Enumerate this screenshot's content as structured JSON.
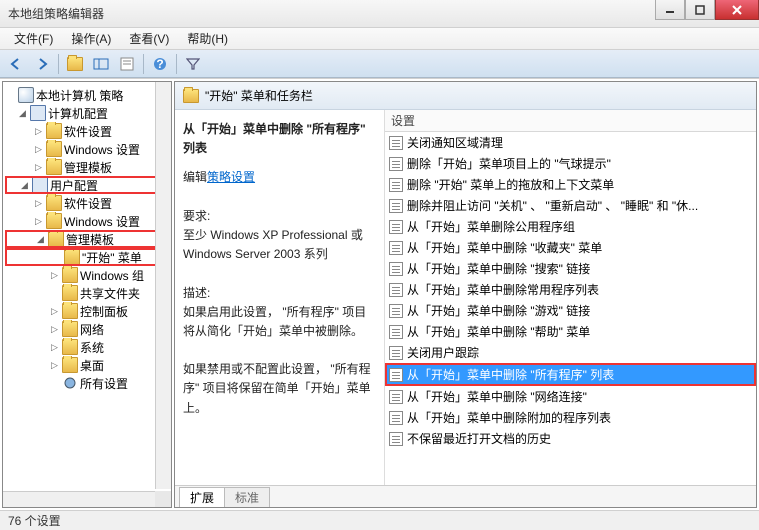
{
  "window": {
    "title": "本地组策略编辑器"
  },
  "menu": {
    "file": "文件(F)",
    "action": "操作(A)",
    "view": "查看(V)",
    "help": "帮助(H)"
  },
  "tree": {
    "root": "本地计算机 策略",
    "computer": "计算机配置",
    "c_software": "软件设置",
    "c_windows": "Windows 设置",
    "c_admin": "管理模板",
    "user": "用户配置",
    "u_software": "软件设置",
    "u_windows": "Windows 设置",
    "u_admin": "管理模板",
    "start_menu": "\"开始\" 菜单",
    "win_comp": "Windows 组",
    "shared": "共享文件夹",
    "cpanel": "控制面板",
    "network": "网络",
    "system": "系统",
    "desktop": "桌面",
    "all_settings": "所有设置"
  },
  "header": {
    "title": "\"开始\" 菜单和任务栏"
  },
  "info": {
    "title": "从「开始」菜单中删除 \"所有程序\" 列表",
    "edit_prefix": "编辑",
    "edit_link": "策略设置",
    "req_label": "要求:",
    "req_text": "至少 Windows XP Professional 或 Windows Server 2003 系列",
    "desc_label": "描述:",
    "desc1": "如果启用此设置， \"所有程序\" 项目将从简化「开始」菜单中被删除。",
    "desc2": "如果禁用或不配置此设置， \"所有程序\" 项目将保留在简单「开始」菜单上。"
  },
  "list": {
    "header": "设置",
    "items": [
      "关闭通知区域清理",
      "删除「开始」菜单项目上的 \"气球提示\"",
      "删除 \"开始\" 菜单上的拖放和上下文菜单",
      "删除并阻止访问 \"关机\" 、 \"重新启动\" 、 \"睡眠\" 和 \"休...",
      "从「开始」菜单删除公用程序组",
      "从「开始」菜单中删除 \"收藏夹\" 菜单",
      "从「开始」菜单中删除 \"搜索\" 链接",
      "从「开始」菜单中删除常用程序列表",
      "从「开始」菜单中删除 \"游戏\" 链接",
      "从「开始」菜单中删除 \"帮助\" 菜单",
      "关闭用户跟踪",
      "从「开始」菜单中删除 \"所有程序\" 列表",
      "从「开始」菜单中删除 \"网络连接\"",
      "从「开始」菜单中删除附加的程序列表",
      "不保留最近打开文档的历史"
    ],
    "selected_index": 11
  },
  "tabs": {
    "extended": "扩展",
    "standard": "标准"
  },
  "status": {
    "count": "76 个设置"
  }
}
